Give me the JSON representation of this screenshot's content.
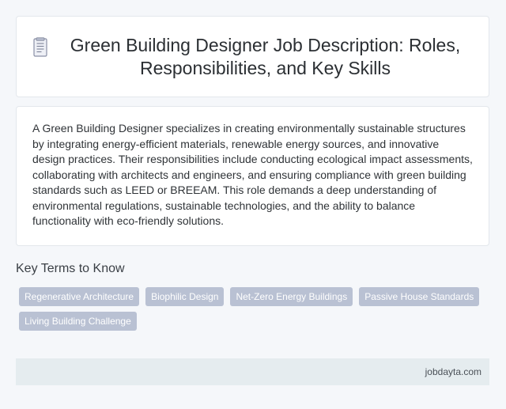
{
  "header": {
    "icon": "document-icon",
    "title": "Green Building Designer Job Description: Roles, Responsibilities, and Key Skills"
  },
  "description": "A Green Building Designer specializes in creating environmentally sustainable structures by integrating energy-efficient materials, renewable energy sources, and innovative design practices. Their responsibilities include conducting ecological impact assessments, collaborating with architects and engineers, and ensuring compliance with green building standards such as LEED or BREEAM. This role demands a deep understanding of environmental regulations, sustainable technologies, and the ability to balance functionality with eco-friendly solutions.",
  "key_terms": {
    "heading": "Key Terms to Know",
    "tags": [
      "Regenerative Architecture",
      "Biophilic Design",
      "Net-Zero Energy Buildings",
      "Passive House Standards",
      "Living Building Challenge"
    ]
  },
  "footer": {
    "site": "jobdayta.com"
  },
  "colors": {
    "background": "#f5f7fa",
    "tag_background": "#b9c1d3",
    "footer_background": "#e5ecef"
  }
}
